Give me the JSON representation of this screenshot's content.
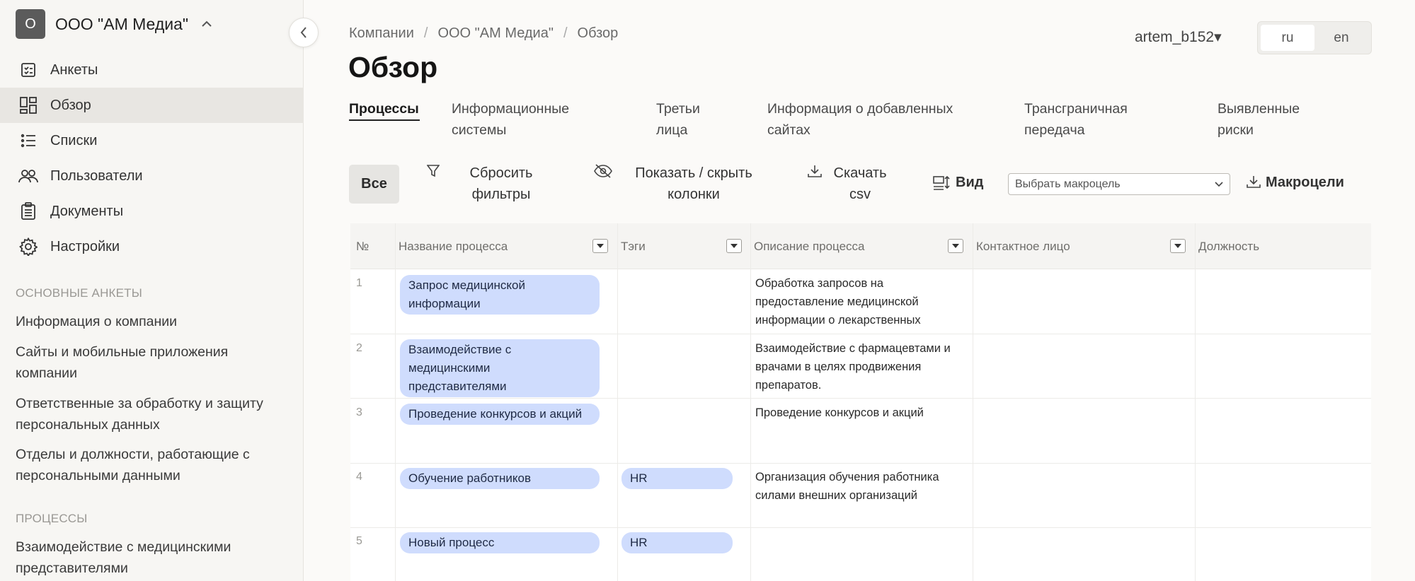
{
  "company": {
    "avatar": "O",
    "name": "ООО \"АМ Медиа\""
  },
  "nav": [
    {
      "label": "Анкеты",
      "icon": "checklist-icon"
    },
    {
      "label": "Обзор",
      "icon": "dashboard-icon"
    },
    {
      "label": "Списки",
      "icon": "list-icon"
    },
    {
      "label": "Пользователи",
      "icon": "users-icon"
    },
    {
      "label": "Документы",
      "icon": "clipboard-icon"
    },
    {
      "label": "Настройки",
      "icon": "gear-icon"
    }
  ],
  "sections": {
    "main_title": "ОСНОВНЫЕ АНКЕТЫ",
    "main_links": [
      "Информация о компании",
      "Сайты и мобильные приложения компании",
      "Ответственные за обработку и защиту персональных данных",
      "Отделы и должности, работающие с персональными данными"
    ],
    "process_title": "ПРОЦЕССЫ",
    "process_links": [
      "Взаимодействие с медицинскими представителями"
    ]
  },
  "breadcrumb": [
    "Компании",
    "ООО \"АМ Медиа\"",
    "Обзор"
  ],
  "page_title": "Обзор",
  "user": "artem_b152▾",
  "langs": [
    "ru",
    "en"
  ],
  "tabs": [
    "Процессы",
    "Информационные системы",
    "Третьи лица",
    "Информация о добавленных сайтах",
    "Трансграничная передача",
    "Выявленные риски"
  ],
  "toolbar": {
    "all": "Все",
    "reset": "Сбросить фильтры",
    "toggle_columns": "Показать / скрыть колонки",
    "download_csv": "Скачать csv",
    "view": "Вид",
    "macro_placeholder": "Выбрать макроцель",
    "macro": "Макроцели"
  },
  "table": {
    "headers": [
      "№",
      "Название процесса",
      "Тэги",
      "Описание процесса",
      "Контактное лицо",
      "Должность"
    ],
    "rows": [
      {
        "num": "1",
        "name": "Запрос медицинской информации",
        "tag": "",
        "desc": "Обработка запросов на предоставление медицинской информации о лекарственных"
      },
      {
        "num": "2",
        "name": "Взаимодействие с медицинскими представителями",
        "tag": "",
        "desc": "Взаимодействие с фармацевтами и врачами в целях продвижения препаратов."
      },
      {
        "num": "3",
        "name": "Проведение конкурсов и акций",
        "tag": "",
        "desc": "Проведение конкурсов и акций"
      },
      {
        "num": "4",
        "name": "Обучение работников",
        "tag": "HR",
        "desc": "Организация обучения работника силами внешних организаций"
      },
      {
        "num": "5",
        "name": "Новый процесс",
        "tag": "HR",
        "desc": ""
      }
    ]
  }
}
